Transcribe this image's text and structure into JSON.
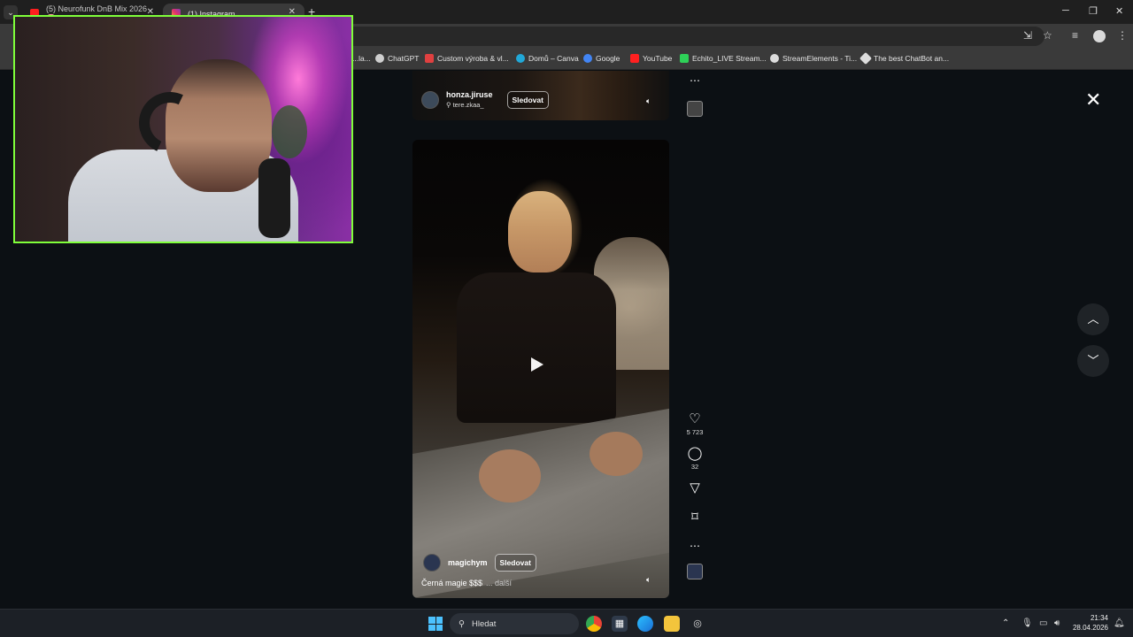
{
  "browser": {
    "tabs": [
      {
        "label": "(5) Neurofunk DnB Mix 2026 🧠",
        "active": false
      },
      {
        "label": "(1) Instagram",
        "active": true
      }
    ],
    "bookmarks": [
      {
        "label": "...la...",
        "color": "#888888"
      },
      {
        "label": "ChatGPT",
        "color": "#cfcfcf"
      },
      {
        "label": "Custom výroba & vl...",
        "color": "#e04040"
      },
      {
        "label": "Domů – Canva",
        "color": "#21a8d8"
      },
      {
        "label": "Google",
        "color": "#4285f4"
      },
      {
        "label": "YouTube",
        "color": "#ff2020"
      },
      {
        "label": "Echito_LIVE Stream...",
        "color": "#2ed158"
      },
      {
        "label": "StreamElements - Ti...",
        "color": "#dddddd"
      },
      {
        "label": "The best ChatBot an...",
        "color": "#dddddd"
      }
    ]
  },
  "reel_top": {
    "username": "honza.jiruse",
    "subtext": "tere.zkaa_",
    "follow_label": "Sledovat"
  },
  "reel_main": {
    "username": "magichym",
    "follow_label": "Sledovat",
    "caption": "Černá magie $$$",
    "more_label": "... další"
  },
  "actions": {
    "likes": "5 723",
    "comments": "32"
  },
  "taskbar": {
    "search_placeholder": "Hledat",
    "time": "21:34",
    "date": "28.04.2026"
  },
  "icons": {
    "like": "heart-icon",
    "comment": "comment-icon",
    "share": "send-icon",
    "save": "bookmark-icon",
    "more": "more-icon",
    "close": "close-icon",
    "up": "chevron-up-icon",
    "down": "chevron-down-icon"
  }
}
